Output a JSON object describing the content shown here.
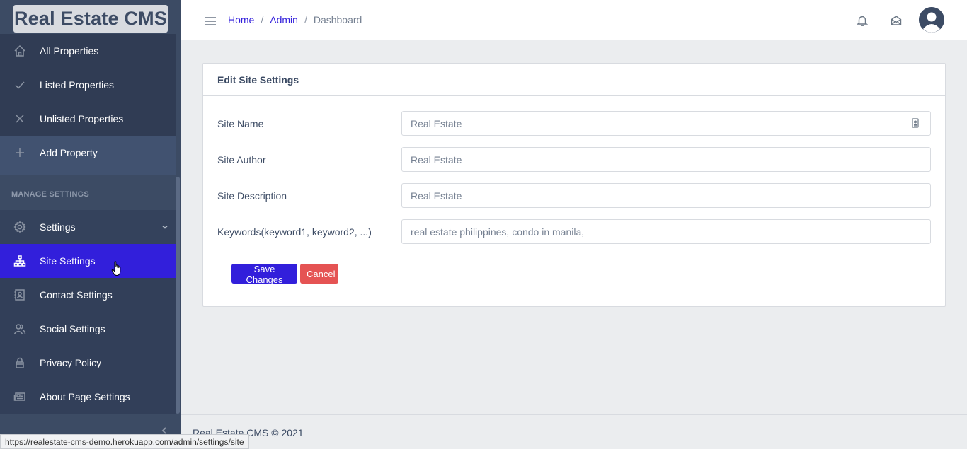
{
  "brand": {
    "name": "Real Estate CMS"
  },
  "sidebar": {
    "items_top": [
      {
        "label": "All Properties",
        "icon": "home-icon"
      },
      {
        "label": "Listed Properties",
        "icon": "check-icon"
      },
      {
        "label": "Unlisted Properties",
        "icon": "x-icon"
      },
      {
        "label": "Add Property",
        "icon": "plus-icon"
      }
    ],
    "section_title": "MANAGE SETTINGS",
    "settings_label": "Settings",
    "settings_items": [
      {
        "label": "Site Settings",
        "icon": "sitemap-icon"
      },
      {
        "label": "Contact Settings",
        "icon": "contact-icon"
      },
      {
        "label": "Social Settings",
        "icon": "people-icon"
      },
      {
        "label": "Privacy Policy",
        "icon": "lock-icon"
      },
      {
        "label": "About Page Settings",
        "icon": "newspaper-icon"
      }
    ]
  },
  "header": {
    "breadcrumb": [
      "Home",
      "Admin",
      "Dashboard"
    ]
  },
  "card": {
    "title": "Edit Site Settings",
    "fields": [
      {
        "label": "Site Name",
        "value": "Real Estate"
      },
      {
        "label": "Site Author",
        "value": "Real Estate"
      },
      {
        "label": "Site Description",
        "value": "Real Estate"
      },
      {
        "label": "Keywords(keyword1, keyword2, ...)",
        "value": "real estate philippines, condo in manila,"
      }
    ],
    "save_label": "Save Changes",
    "cancel_label": "Cancel"
  },
  "footer": {
    "text": "Real Estate CMS © 2021"
  },
  "status_url": "https://realestate-cms-demo.herokuapp.com/admin/settings/site",
  "colors": {
    "sidebar": "#3c4b64",
    "primary": "#321fdb",
    "danger": "#e55353"
  }
}
